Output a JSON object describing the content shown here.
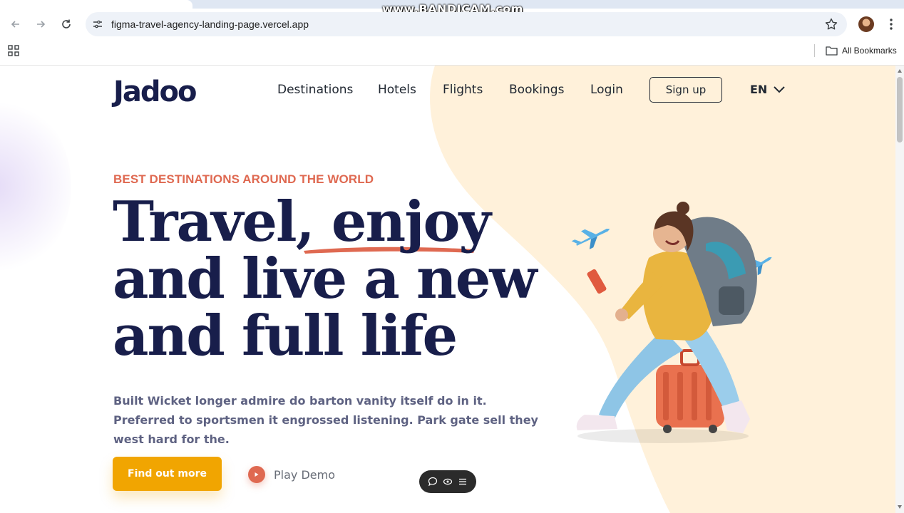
{
  "browser": {
    "url": "figma-travel-agency-landing-page.vercel.app",
    "bookmarks_label": "All Bookmarks",
    "watermark": "www.BANDICAM.com"
  },
  "nav": {
    "logo": "Jadoo",
    "links": [
      "Destinations",
      "Hotels",
      "Flights",
      "Bookings",
      "Login"
    ],
    "signup": "Sign up",
    "language": "EN"
  },
  "hero": {
    "tagline": "BEST DESTINATIONS AROUND THE WORLD",
    "headline_line1_a": "Travel, ",
    "headline_line1_b": "enjoy",
    "headline_line2": "and live a new",
    "headline_line3": "and full life",
    "description": "Built Wicket longer admire do barton vanity itself do in it. Preferred to sportsmen it engrossed listening. Park gate sell they west hard for the.",
    "cta_primary": "Find out more",
    "cta_secondary": "Play Demo"
  },
  "colors": {
    "brand_navy": "#181e4b",
    "accent_orange": "#df6951",
    "cta_yellow": "#f1a501",
    "blob_cream": "#fff1da"
  },
  "icons": {
    "back": "arrow-left-icon",
    "forward": "arrow-right-icon",
    "reload": "reload-icon",
    "site_info": "tune-icon",
    "bookmark": "star-icon",
    "menu": "kebab-menu-icon",
    "apps": "apps-grid-icon",
    "folder": "folder-icon",
    "language_dropdown": "chevron-down-icon",
    "play": "play-icon"
  }
}
